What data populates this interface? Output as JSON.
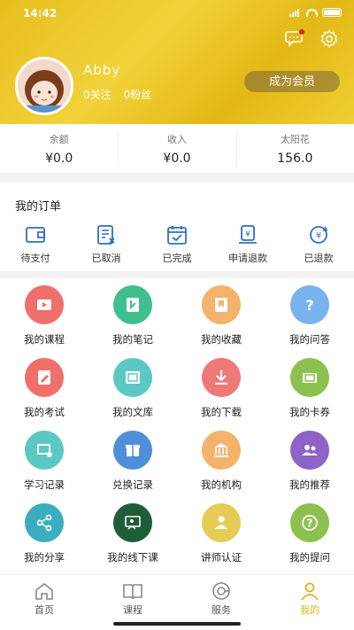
{
  "status": {
    "time": "14:42"
  },
  "profile": {
    "name": "Abby",
    "following": "0关注",
    "fans": "0粉丝",
    "vip_label": "成为会员"
  },
  "stats": [
    {
      "label": "余额",
      "value": "¥0.0"
    },
    {
      "label": "收入",
      "value": "¥0.0"
    },
    {
      "label": "太阳花",
      "value": "156.0"
    }
  ],
  "orders": {
    "title": "我的订单",
    "items": [
      {
        "label": "待支付",
        "icon": "wallet-icon"
      },
      {
        "label": "已取消",
        "icon": "cancel-doc-icon"
      },
      {
        "label": "已完成",
        "icon": "calendar-check-icon"
      },
      {
        "label": "申请退款",
        "icon": "refund-request-icon"
      },
      {
        "label": "已退款",
        "icon": "refunded-icon"
      }
    ]
  },
  "features": [
    {
      "label": "我的课程",
      "icon": "video-icon",
      "color": "#ef6f6a"
    },
    {
      "label": "我的笔记",
      "icon": "note-icon",
      "color": "#3fbf8d"
    },
    {
      "label": "我的收藏",
      "icon": "bookmark-icon",
      "color": "#f4b26b"
    },
    {
      "label": "我的问答",
      "icon": "question-icon",
      "color": "#79b3ee"
    },
    {
      "label": "我的考试",
      "icon": "exam-icon",
      "color": "#ef6f6a"
    },
    {
      "label": "我的文库",
      "icon": "library-icon",
      "color": "#5cc8c4"
    },
    {
      "label": "我的下载",
      "icon": "download-icon",
      "color": "#ef7878"
    },
    {
      "label": "我的卡券",
      "icon": "coupon-icon",
      "color": "#8cc14f"
    },
    {
      "label": "学习记录",
      "icon": "study-record-icon",
      "color": "#5cc8c4"
    },
    {
      "label": "兑换记录",
      "icon": "exchange-icon",
      "color": "#4f8fd9"
    },
    {
      "label": "我的机构",
      "icon": "institution-icon",
      "color": "#f4b26b"
    },
    {
      "label": "我的推荐",
      "icon": "recommend-icon",
      "color": "#8e63c7"
    },
    {
      "label": "我的分享",
      "icon": "share-icon",
      "color": "#3aaec0"
    },
    {
      "label": "我的线下课",
      "icon": "offline-class-icon",
      "color": "#1e5d3a"
    },
    {
      "label": "讲师认证",
      "icon": "lecturer-icon",
      "color": "#e5cd55"
    },
    {
      "label": "我的提问",
      "icon": "ask-icon",
      "color": "#8cc14f"
    }
  ],
  "tabs": [
    {
      "label": "首页",
      "icon": "home-icon"
    },
    {
      "label": "课程",
      "icon": "book-icon"
    },
    {
      "label": "服务",
      "icon": "service-icon"
    },
    {
      "label": "我的",
      "icon": "user-icon"
    }
  ],
  "colors": {
    "accent": "#e0b51c",
    "header": "#e9c226"
  }
}
